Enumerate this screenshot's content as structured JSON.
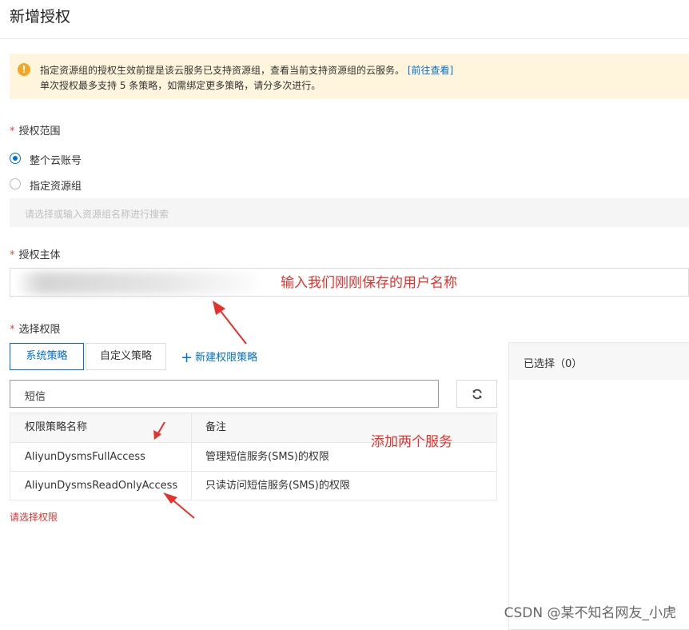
{
  "page": {
    "title": "新增授权"
  },
  "notice": {
    "line1_text": "指定资源组的授权生效前提是该云服务已支持资源组，查看当前支持资源组的云服务。",
    "line1_link": "[前往查看]",
    "line2_text": "单次授权最多支持 5 条策略，如需绑定更多策略，请分多次进行。"
  },
  "scope": {
    "required_mark": "*",
    "label": "授权范围",
    "options": [
      {
        "label": "整个云账号",
        "checked": true
      },
      {
        "label": "指定资源组",
        "checked": false
      }
    ],
    "resource_group_placeholder": "请选择或输入资源组名称进行搜索"
  },
  "principal": {
    "required_mark": "*",
    "label": "授权主体",
    "annotation": "输入我们刚刚保存的用户名称"
  },
  "permissions": {
    "required_mark": "*",
    "label": "选择权限",
    "tabs": [
      {
        "label": "系统策略",
        "active": true
      },
      {
        "label": "自定义策略",
        "active": false
      }
    ],
    "new_policy": "新建权限策略",
    "search_value": "短信",
    "table": {
      "columns": [
        "权限策略名称",
        "备注"
      ],
      "rows": [
        {
          "name": "AliyunDysmsFullAccess",
          "note": "管理短信服务(SMS)的权限"
        },
        {
          "name": "AliyunDysmsReadOnlyAccess",
          "note": "只读访问短信服务(SMS)的权限"
        }
      ]
    },
    "annotation": "添加两个服务",
    "error": "请选择权限"
  },
  "selected_panel": {
    "title": "已选择（0）"
  },
  "watermark": "CSDN @某不知名网友_小虎",
  "colors": {
    "primary": "#0070cc",
    "annotation": "#e5322d",
    "warning": "#f5a623"
  }
}
